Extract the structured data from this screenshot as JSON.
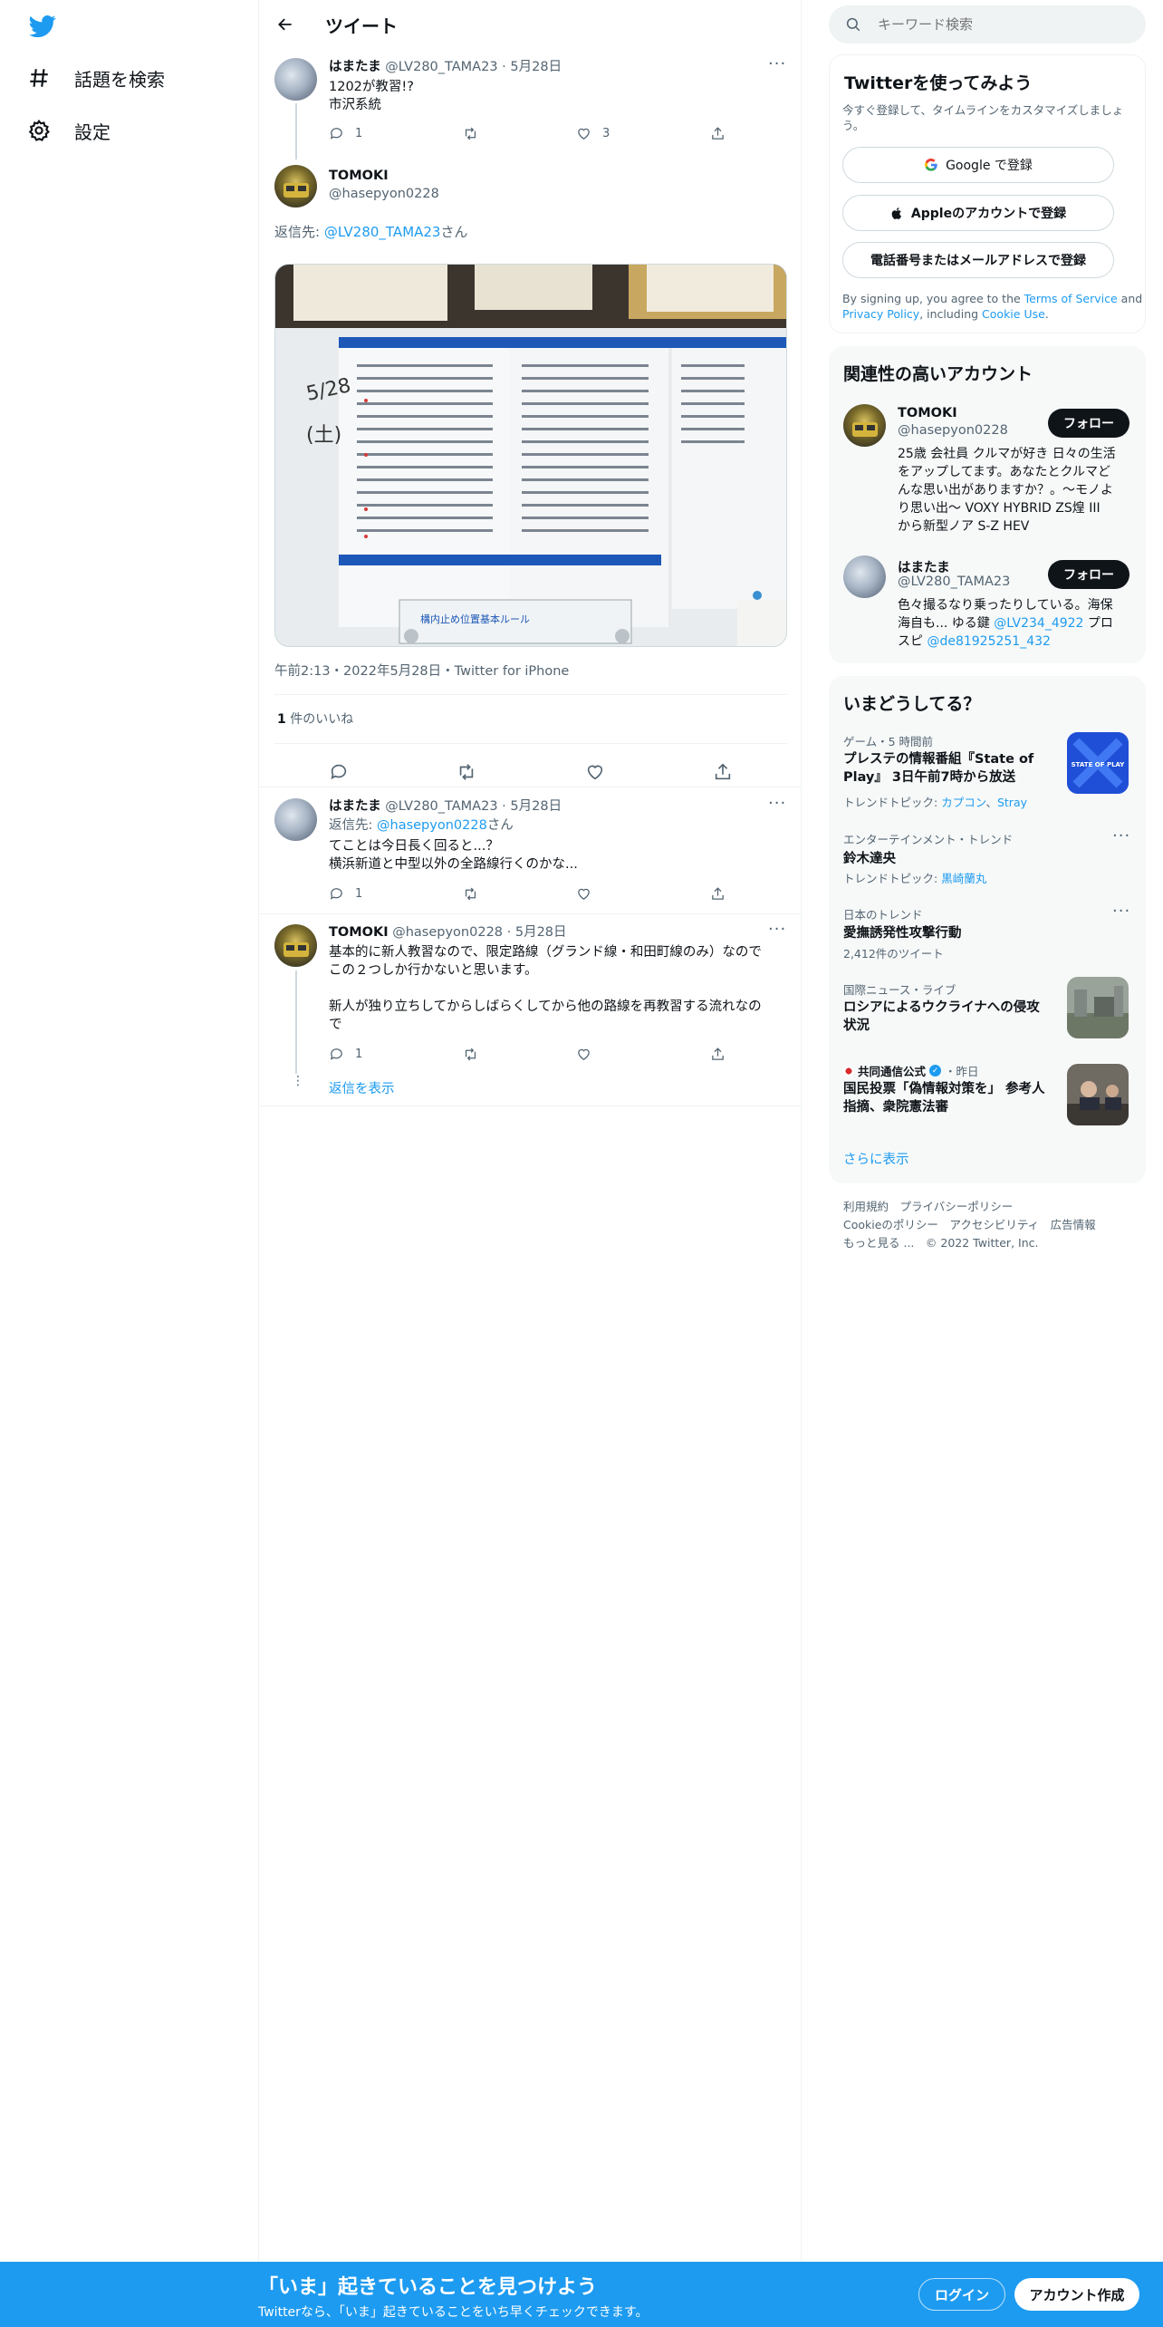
{
  "nav": {
    "items": [
      {
        "label": "話題を検索",
        "icon": "hashtag-icon"
      },
      {
        "label": "設定",
        "icon": "gear-icon"
      }
    ]
  },
  "header": {
    "title": "ツイート"
  },
  "thread": {
    "parent": {
      "name": "はまたま",
      "handle": "@LV280_TAMA23",
      "date": "5月28日",
      "lines": [
        "1202が教習!?",
        "市沢系統"
      ],
      "reply_count": "1",
      "like_count": "3"
    },
    "main": {
      "name": "TOMOKI",
      "handle": "@hasepyon0228",
      "reply_to_label": "返信先: ",
      "reply_to_user": "@LV280_TAMA23",
      "reply_to_suffix": "さん",
      "photo": {
        "board_date": "5/28",
        "board_day": "(土)",
        "sign_text": "構内止め位置基本ルール"
      },
      "timestamp": "午前2:13・2022年5月28日・Twitter for iPhone",
      "likes_count": "1",
      "likes_label": " 件のいいね"
    },
    "replies": [
      {
        "name": "はまたま",
        "handle": "@LV280_TAMA23",
        "date": "5月28日",
        "reply_to_label": "返信先: ",
        "reply_to_user": "@hasepyon0228",
        "reply_to_suffix": "さん",
        "lines": [
          "てことは今日長く回ると...？",
          "横浜新道と中型以外の全路線行くのかな..."
        ],
        "reply_count": "1"
      },
      {
        "name": "TOMOKI",
        "handle": "@hasepyon0228",
        "date": "5月28日",
        "lines": [
          "基本的に新人教習なので、限定路線（グランド線・和田町線のみ）なので",
          "この２つしか行かないと思います。",
          "",
          "新人が独り立ちしてからしばらくしてから他の路線を再教習する流れなの",
          "で"
        ],
        "reply_count": "1"
      }
    ],
    "show_replies": "返信を表示"
  },
  "right": {
    "search_placeholder": "キーワード検索",
    "signup": {
      "title": "Twitterを使ってみよう",
      "subtitle_lines": [
        "今すぐ登録して、タイムラインをカスタマイズしましょ",
        "う。"
      ],
      "google": "Google で登録",
      "apple": "Appleのアカウントで登録",
      "phone": "電話番号またはメールアドレスで登録",
      "terms_prefix": "By signing up, you agree to the ",
      "terms": "Terms of Service",
      "and": " and",
      "privacy": "Privacy Policy",
      "including": ", including ",
      "cookie": "Cookie Use",
      "period": "."
    },
    "relevant": {
      "title": "関連性の高いアカウント",
      "follow": "フォロー",
      "accounts": [
        {
          "name": "TOMOKI",
          "handle": "@hasepyon0228",
          "bio_lines": [
            "25歳 会社員 クルマが好き 日々の生活",
            "をアップしてます。あなたとクルマど",
            "んな思い出がありますか？。〜モノよ",
            "り思い出〜 VOXY HYBRID ZS煌 III",
            "から新型ノア S-Z HEV"
          ]
        },
        {
          "name": "はまたま",
          "handle": "@LV280_TAMA23",
          "bio_line1": "色々撮るなり乗ったりしている。海保",
          "bio_line2_a": "海自も... ゆる鍵 ",
          "bio_line2_link": "@LV234_4922",
          "bio_line2_b": " プロ",
          "bio_line3_a": "スピ ",
          "bio_line3_link": "@de81925251_432"
        }
      ]
    },
    "trends": {
      "title": "いまどうしてる？",
      "items": [
        {
          "meta": "ゲーム・5 時間前",
          "title_lines": [
            "プレステの情報番組『State of",
            "Play』 3日午前7時から放送"
          ],
          "topic_label": "トレンドトピック: ",
          "topic_a": "カプコン",
          "sep": "、",
          "topic_b": "Stray",
          "thumb_text": "STATE OF PLAY"
        },
        {
          "meta": "エンターテインメント・トレンド",
          "title": "鈴木達央",
          "topic_label": "トレンドトピック: ",
          "topic_a": "黒崎蘭丸"
        },
        {
          "meta": "日本のトレンド",
          "title": "愛撫誘発性攻撃行動",
          "count": "2,412件のツイート"
        },
        {
          "meta": "国際ニュース・ライブ",
          "title_lines": [
            "ロシアによるウクライナへの侵攻",
            "状況"
          ]
        },
        {
          "source": "共同通信公式",
          "time": "・昨日",
          "title_lines": [
            "国民投票「偽情報対策を」 参考人",
            "指摘、衆院憲法審"
          ]
        }
      ],
      "show_more": "さらに表示"
    },
    "footer": {
      "row1": [
        "利用規約",
        "プライバシーポリシー"
      ],
      "row2": [
        "Cookieのポリシー",
        "アクセシビリティ",
        "広告情報"
      ],
      "more": "もっと見る ...",
      "copyright": "© 2022 Twitter, Inc."
    }
  },
  "banner": {
    "title": "「いま」起きていることを見つけよう",
    "subtitle": "Twitterなら、「いま」起きていることをいち早くチェックできます。",
    "login": "ログイン",
    "signup": "アカウント作成"
  },
  "colors": {
    "accent": "#1d9bf0",
    "text": "#0f1419",
    "muted": "#536471",
    "border": "#eff3f4"
  }
}
